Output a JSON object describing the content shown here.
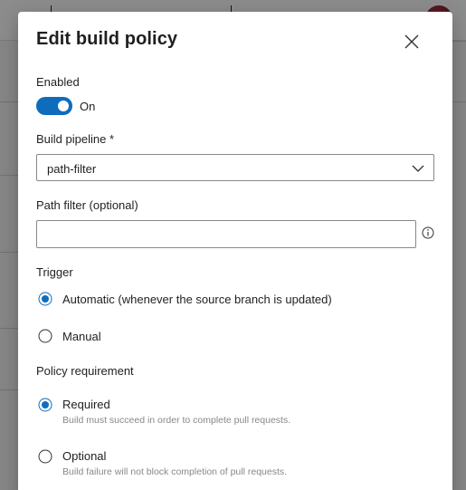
{
  "dialog": {
    "title": "Edit build policy",
    "enabled_label": "Enabled",
    "toggle_state_label": "On",
    "pipeline_label": "Build pipeline *",
    "pipeline_value": "path-filter",
    "path_filter_label": "Path filter (optional)",
    "path_filter_value": "",
    "path_filter_placeholder": "",
    "trigger_label": "Trigger",
    "trigger_options": [
      {
        "label": "Automatic (whenever the source branch is updated)",
        "selected": true
      },
      {
        "label": "Manual",
        "selected": false
      }
    ],
    "policy_label": "Policy requirement",
    "policy_options": [
      {
        "label": "Required",
        "description": "Build must succeed in order to complete pull requests.",
        "selected": true
      },
      {
        "label": "Optional",
        "description": "Build failure will not block completion of pull requests.",
        "selected": false
      }
    ]
  },
  "colors": {
    "accent": "#0f6cbd",
    "text": "#201f1e",
    "secondary_text": "#8a8886",
    "border": "#8a8886"
  },
  "icons": {
    "close": "close-icon",
    "chevron": "chevron-down-icon",
    "info": "info-icon"
  }
}
